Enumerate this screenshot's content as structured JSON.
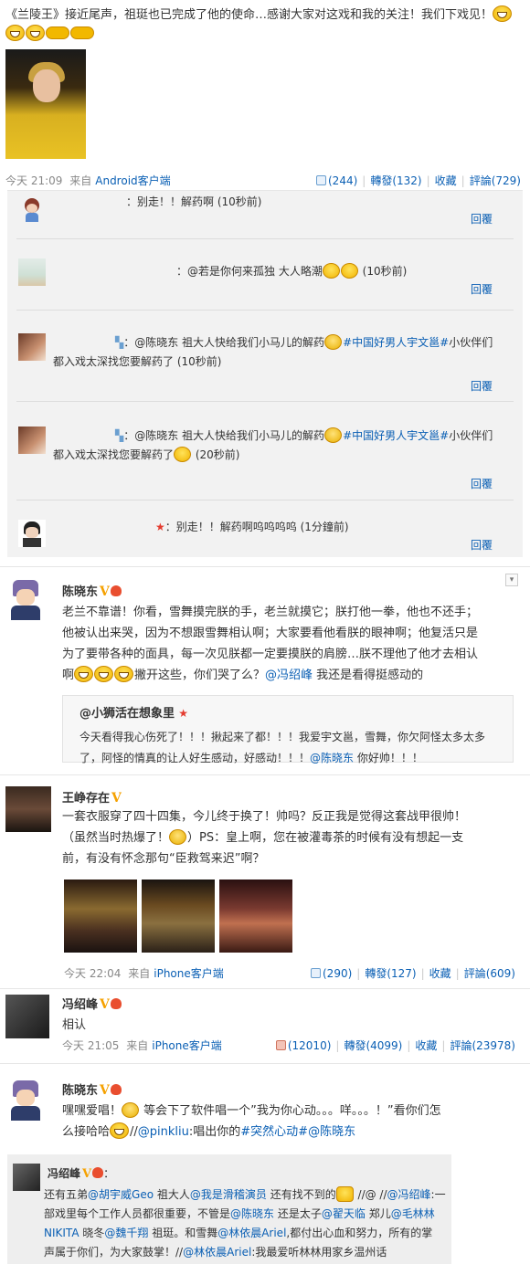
{
  "post1": {
    "text_parts": [
      "《兰陵王》接近尾声，祖珽也已完成了他的使命…感谢大家对这戏和我的关注！我们下戏见！"
    ],
    "meta": {
      "time": "今天 21:09",
      "source_prefix": "来自",
      "source": "Android客户端"
    },
    "actions": {
      "like": "(244)",
      "repost": "轉發(132)",
      "fav": "收藏",
      "comment": "評論(729)"
    }
  },
  "comments": [
    {
      "text": "：别走！！解药啊 (10秒前)",
      "reply": "回覆"
    },
    {
      "text": "：@若是你何来孤独 大人略潮",
      "time": " (10秒前)",
      "reply": "回覆"
    },
    {
      "line1": "：@陈晓东 祖大人快给我们小马儿的解药",
      "tag": "#中国好男人宇文邕#",
      "line1b": "小伙伴们",
      "line2": "都入戏太深找您要解药了 (10秒前)",
      "reply": "回覆"
    },
    {
      "line1": "：@陈晓东 祖大人快给我们小马儿的解药",
      "tag": "#中国好男人宇文邕#",
      "line1b": "小伙伴们",
      "line2": "都入戏太深找您要解药了",
      "time": " (20秒前)",
      "reply": "回覆"
    },
    {
      "text": "：别走！！解药啊呜呜呜呜 (1分鐘前)",
      "reply": "回覆"
    }
  ],
  "post2": {
    "name": "陈晓东",
    "body_lines": [
      "老兰不靠谱！你看，雪舞摸完朕的手，老兰就摸它；朕打他一拳，他也不还手；",
      "他被认出来哭，因为不想跟雪舞相认啊；大家要看他看朕的眼神啊；他复活只是",
      "为了要带各种的面具，每一次见朕都一定要摸朕的肩膀…朕不理他了他才去相认"
    ],
    "body_line4_after": "撇开这些，你们哭了么？",
    "mention": "@冯绍峰",
    "body_line4_end": " 我还是看得挺感动的",
    "repost_name": "@小狮活在想象里",
    "repost_lines": [
      "今天看得我心伤死了！！！揪起来了都！！！我爱宇文邕，雪舞，你欠阿怪太多太多",
      "了，阿怪的情真的让人好生感动，好感动！！！"
    ],
    "repost_mention": "@陈晓东",
    "repost_end": " 你好帅！！！"
  },
  "post3": {
    "name": "王峥存在",
    "body_lines": [
      "一套衣服穿了四十四集，今儿终于换了！帅吗？反正我是觉得这套战甲很帅！",
      "（虽然当时热爆了！",
      "前，有没有怀念那句“臣救驾来迟”啊？"
    ],
    "line2_end": "）PS：皇上啊，您在被灌毒茶的时候有没有想起一支",
    "meta": {
      "time": "今天 22:04",
      "source_prefix": "来自",
      "source": "iPhone客户端"
    },
    "actions": {
      "like": "(290)",
      "repost": "轉發(127)",
      "fav": "收藏",
      "comment": "評論(609)"
    }
  },
  "post4": {
    "name": "冯绍峰",
    "body": "相认",
    "meta": {
      "time": "今天 21:05",
      "source_prefix": "来自",
      "source": "iPhone客户端"
    },
    "actions": {
      "like": "(12010)",
      "repost": "轉發(4099)",
      "fav": "收藏",
      "comment": "評論(23978)"
    }
  },
  "post5": {
    "name": "陈晓东",
    "line1_a": "嘿嘿爱唱！",
    "line1_b": " 等会下了软件唱一个”我为你心动。。。咩。。。！”看你们怎",
    "line2_a": "么接哈哈",
    "line2_b": "//",
    "mention": "@pinkliu",
    "line2_c": ":唱出你的",
    "tag": "#突然心动#",
    "mention2": "@陈晓东"
  },
  "post6": {
    "name": "冯绍峰",
    "colon": "：",
    "lines": [
      {
        "parts": [
          [
            "还有五弟",
            "t"
          ],
          [
            "@胡宇威Geo",
            "l"
          ],
          [
            " 祖大人",
            "t"
          ],
          [
            "@我是滑稽演员",
            "l"
          ],
          [
            " 还有找不到的",
            "t"
          ]
        ]
      },
      {
        "parts": [
          [
            "部戏里每个工作人员都很重要，不管是",
            "t"
          ],
          [
            "@陈晓东",
            "l"
          ],
          [
            " 还是太子",
            "t"
          ],
          [
            "@翟天临",
            "l"
          ],
          [
            " 郑儿",
            "t"
          ],
          [
            "@毛林林",
            "l"
          ]
        ]
      },
      {
        "parts": [
          [
            "NIKITA",
            "l"
          ],
          [
            " 晓冬",
            "t"
          ],
          [
            "@魏千翔",
            "l"
          ],
          [
            " 祖珽。和雪舞",
            "t"
          ],
          [
            "@林依晨Ariel",
            "l"
          ],
          [
            ",都付出心血和努力，所有的掌",
            "t"
          ]
        ]
      },
      {
        "parts": [
          [
            "声属于你们，为大家鼓掌！",
            "t"
          ],
          [
            "//",
            "t"
          ],
          [
            "@林依晨Ariel",
            "l"
          ],
          [
            ":我最爱听林林用家乡温州话",
            "t"
          ]
        ]
      }
    ],
    "line1_tail_a": " //@ //",
    "line1_tail_b": "@冯绍峰",
    "line1_tail_c": ":一"
  },
  "colors": {
    "link": "#0a5fb4",
    "tag": "#0a5fb4",
    "vip": "#f5a100",
    "panel": "#f2f2f2"
  }
}
